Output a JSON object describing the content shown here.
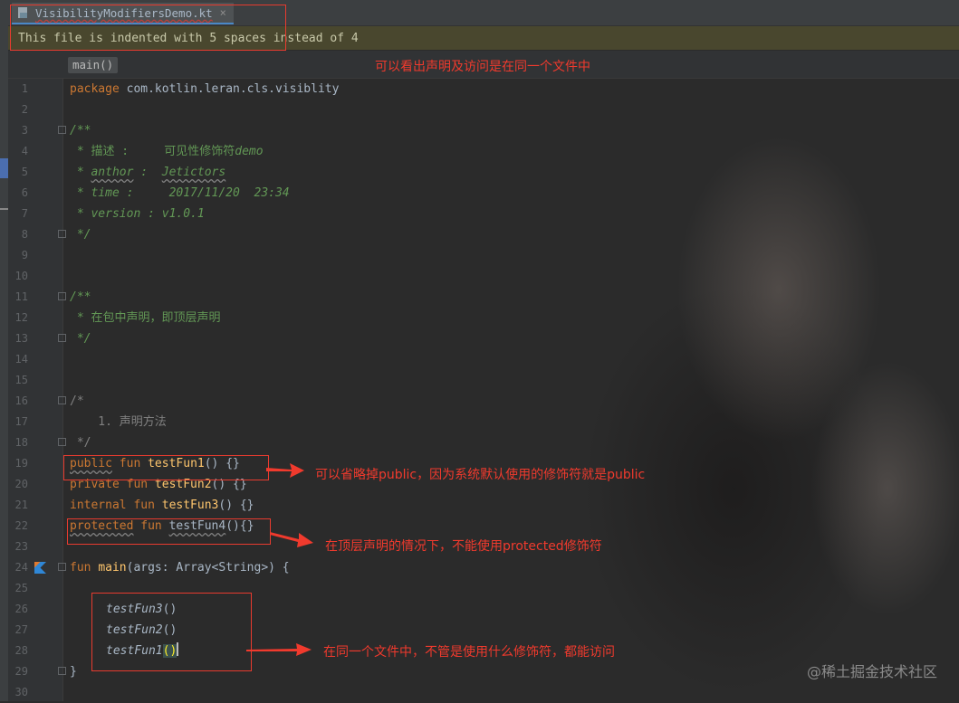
{
  "tab": {
    "filename": "VisibilityModifiersDemo.kt",
    "close_glyph": "×"
  },
  "notice": {
    "text": "This file is indented with 5 spaces instead of 4"
  },
  "breadcrumb": {
    "label": "main()"
  },
  "annotations": {
    "top": "可以看出声明及访问是在同一个文件中",
    "public": "可以省略掉public，因为系统默认使用的修饰符就是public",
    "protected": "在顶层声明的情况下，不能使用protected修饰符",
    "same_file": "在同一个文件中，不管是使用什么修饰符，都能访问"
  },
  "watermark": "@稀土掘金技术社区",
  "code_lines": [
    {
      "n": "1"
    },
    {
      "n": "2"
    },
    {
      "n": "3"
    },
    {
      "n": "4"
    },
    {
      "n": "5"
    },
    {
      "n": "6"
    },
    {
      "n": "7"
    },
    {
      "n": "8"
    },
    {
      "n": "9"
    },
    {
      "n": "10"
    },
    {
      "n": "11"
    },
    {
      "n": "12"
    },
    {
      "n": "13"
    },
    {
      "n": "14"
    },
    {
      "n": "15"
    },
    {
      "n": "16"
    },
    {
      "n": "17"
    },
    {
      "n": "18"
    },
    {
      "n": "19"
    },
    {
      "n": "20"
    },
    {
      "n": "21"
    },
    {
      "n": "22"
    },
    {
      "n": "23"
    },
    {
      "n": "24"
    },
    {
      "n": "25"
    },
    {
      "n": "26"
    },
    {
      "n": "27"
    },
    {
      "n": "28"
    },
    {
      "n": "29"
    },
    {
      "n": "30"
    }
  ],
  "code": {
    "l1_kw": "package",
    "l1_rest": " com.kotlin.leran.cls.visiblity",
    "l3": "/**",
    "l4_a": " * 描述 :     可见性修饰符",
    "l4_b": "demo",
    "l5_a": " * ",
    "l5_b": "anthor",
    "l5_c": " :  ",
    "l5_d": "Jetictors",
    "l6": " * time :     2017/11/20  23:34",
    "l7": " * version : v1.0.1",
    "l8": " */",
    "l11": "/**",
    "l12": " * 在包中声明，即顶层声明",
    "l13": " */",
    "l16": "/*",
    "l17": "    1. 声明方法",
    "l18": " */",
    "l19_kw1": "public",
    "l19_kw2": " fun ",
    "l19_fn": "testFun1",
    "l19_rest": "() {}",
    "l20_kw": "private fun ",
    "l20_fn": "testFun2",
    "l20_rest": "() {}",
    "l21_kw": "internal fun ",
    "l21_fn": "testFun3",
    "l21_rest": "() {}",
    "l22_kw1": "protected",
    "l22_kw2": " fun ",
    "l22_fn": "testFun4",
    "l22_rest": "(){}",
    "l24_kw": "fun ",
    "l24_fn": "main",
    "l24_rest": "(args: Array<String>) {",
    "l26": "testFun3",
    "l26_rest": "()",
    "l27": "testFun2",
    "l27_rest": "()",
    "l28": "testFun1",
    "l28_open": "(",
    "l28_close": ")",
    "l29": "}"
  },
  "colors": {
    "annotation": "#f03a2d",
    "keyword": "#cc7832",
    "function": "#ffc66d",
    "comment": "#629755"
  }
}
